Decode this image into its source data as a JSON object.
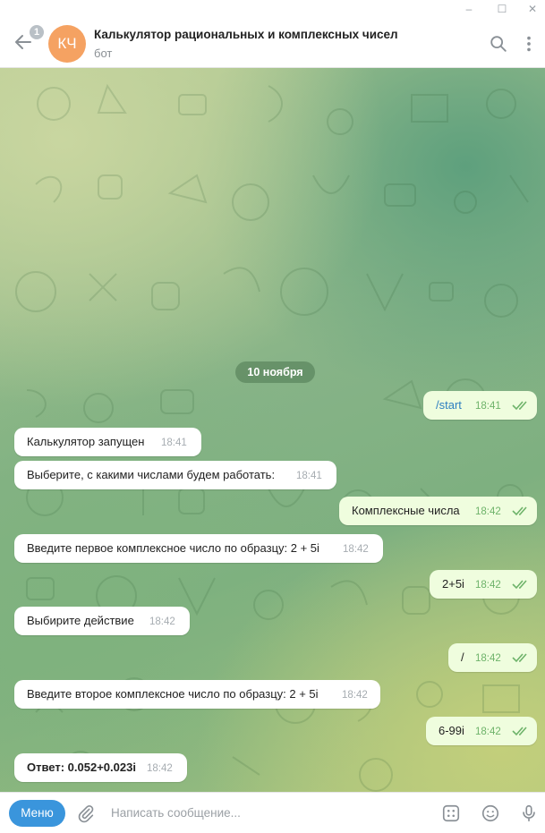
{
  "window": {
    "minimize": "–",
    "maximize": "☐",
    "close": "✕"
  },
  "header": {
    "back_badge": "1",
    "avatar_initials": "КЧ",
    "title": "Калькулятор рациональных и комплексных чисел",
    "subtitle": "бот"
  },
  "chat": {
    "date": "10 ноября",
    "messages": [
      {
        "dir": "out",
        "text": "/start",
        "time": "18:41"
      },
      {
        "dir": "in",
        "text": "Калькулятор запущен",
        "time": "18:41"
      },
      {
        "dir": "in",
        "text": "Выберите, с какими числами будем работать:",
        "time": "18:41"
      },
      {
        "dir": "out",
        "text": "Комплексные числа",
        "time": "18:42"
      },
      {
        "dir": "in",
        "text": "Введите первое комплексное число по образцу: 2 + 5i",
        "time": "18:42"
      },
      {
        "dir": "out",
        "text": "2+5i",
        "time": "18:42"
      },
      {
        "dir": "in",
        "text": "Выбирите действие",
        "time": "18:42"
      },
      {
        "dir": "out",
        "text": "/",
        "time": "18:42"
      },
      {
        "dir": "in",
        "text": "Введите второе комплексное число по образцу: 2 + 5i",
        "time": "18:42"
      },
      {
        "dir": "out",
        "text": "6-99i",
        "time": "18:42"
      },
      {
        "dir": "in",
        "text": "Ответ: 0.052+0.023i",
        "time": "18:42"
      }
    ]
  },
  "composer": {
    "menu_label": "Меню",
    "placeholder": "Написать сообщение..."
  },
  "colors": {
    "accent": "#3a95dc",
    "avatar": "#f5a262",
    "outgoing_bubble": "#effdde",
    "read_ticks": "#6eb36a"
  }
}
